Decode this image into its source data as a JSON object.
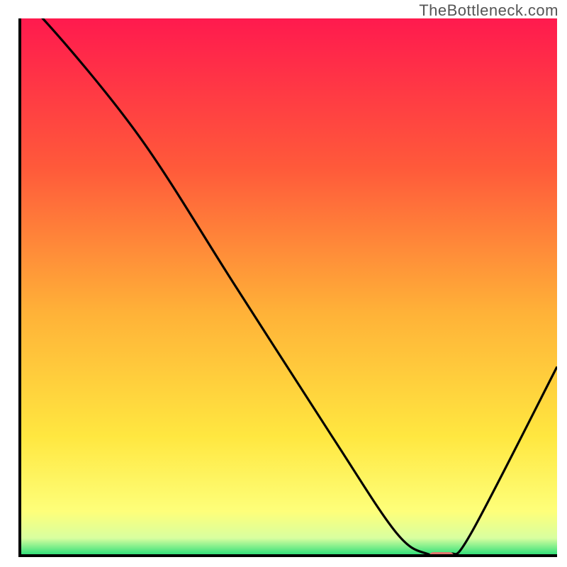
{
  "watermark": "TheBottleneck.com",
  "colors": {
    "gradient": [
      {
        "offset": "0%",
        "color": "#ff1a4e"
      },
      {
        "offset": "28%",
        "color": "#ff5a3a"
      },
      {
        "offset": "55%",
        "color": "#ffb238"
      },
      {
        "offset": "78%",
        "color": "#ffe740"
      },
      {
        "offset": "92%",
        "color": "#feff7a"
      },
      {
        "offset": "97%",
        "color": "#d8ffa0"
      },
      {
        "offset": "100%",
        "color": "#34e07a"
      }
    ],
    "marker": "#e2766f",
    "curve": "#000000"
  },
  "chart_data": {
    "type": "line",
    "title": "",
    "xlabel": "",
    "ylabel": "",
    "xlim": [
      0,
      100
    ],
    "ylim": [
      0,
      100
    ],
    "x": [
      0,
      4,
      22,
      40,
      58,
      70,
      76,
      80,
      84,
      100
    ],
    "values": [
      102,
      100,
      78,
      50,
      22,
      4,
      0,
      0,
      4,
      35
    ],
    "marker_x": 78,
    "marker_y": 0,
    "annotations": []
  }
}
